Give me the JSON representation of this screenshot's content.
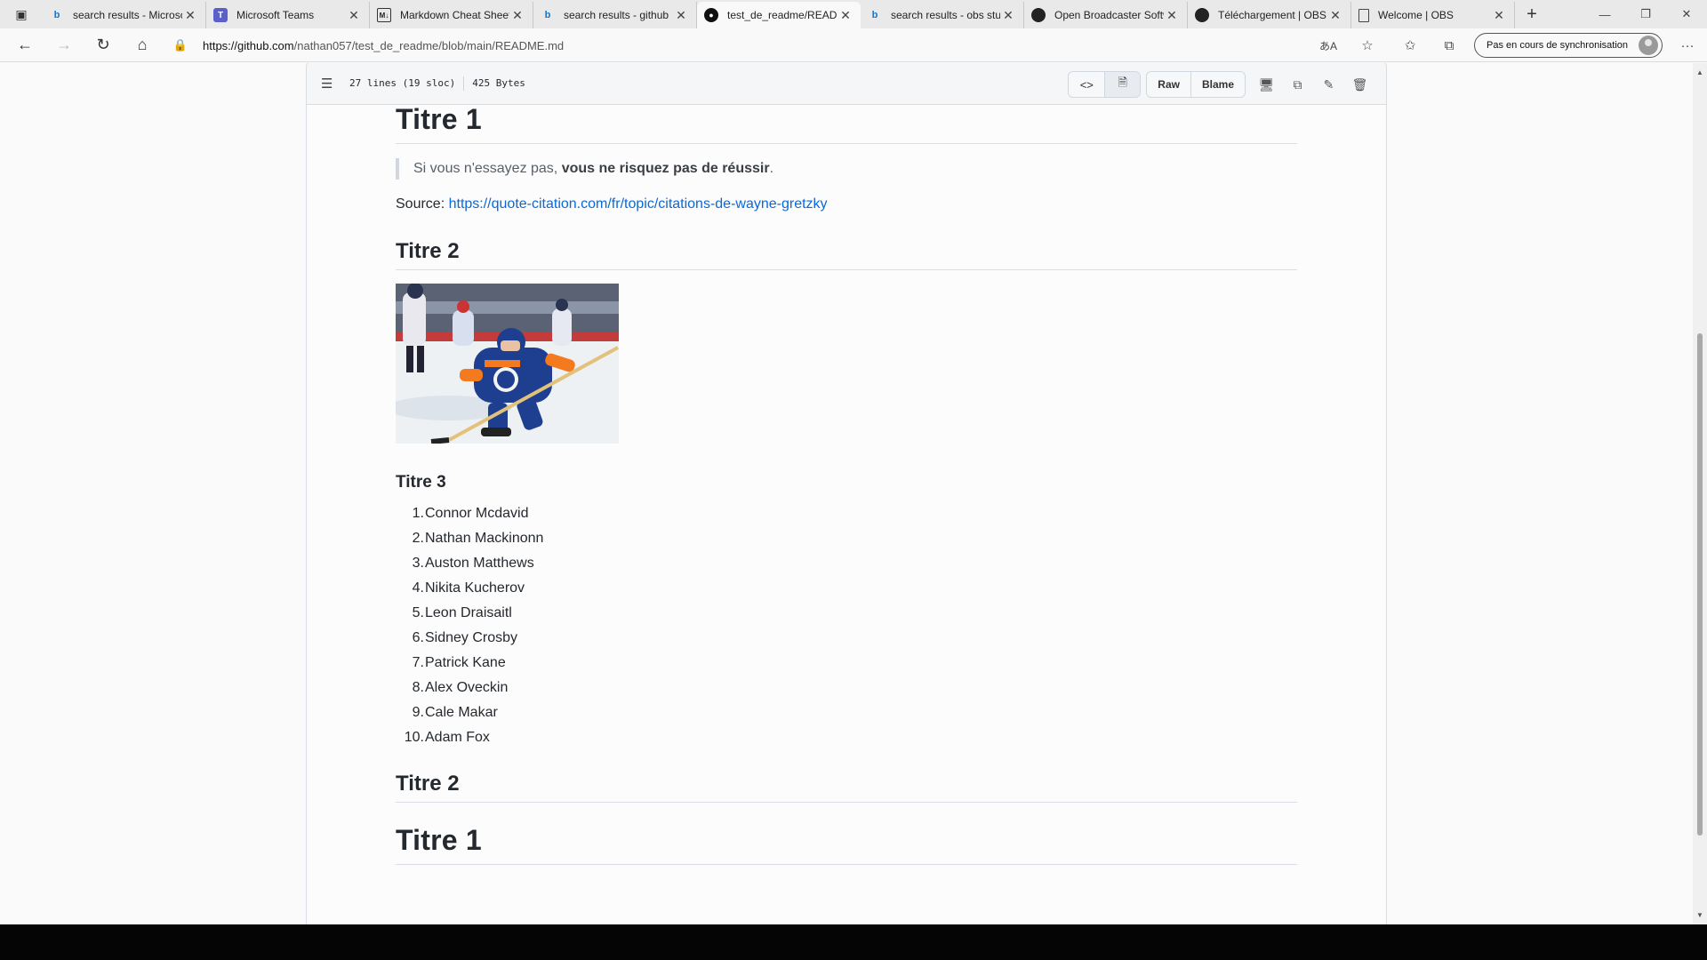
{
  "browser": {
    "tabs": [
      {
        "title": "search results - Microsoft",
        "icon": "bing-icon",
        "active": false
      },
      {
        "title": "Microsoft Teams",
        "icon": "teams-icon",
        "active": false
      },
      {
        "title": "Markdown Cheat Sheet",
        "icon": "markdown-icon",
        "active": false
      },
      {
        "title": "search results - github",
        "icon": "bing-icon",
        "active": false
      },
      {
        "title": "test_de_readme/README.md",
        "icon": "github-icon",
        "active": true
      },
      {
        "title": "search results - obs studio",
        "icon": "bing-icon",
        "active": false
      },
      {
        "title": "Open Broadcaster Software",
        "icon": "obs-icon",
        "active": false
      },
      {
        "title": "Téléchargement | OBS",
        "icon": "obs-icon",
        "active": false
      },
      {
        "title": "Welcome | OBS",
        "icon": "page-icon",
        "active": false
      }
    ],
    "url_domain": "https://github.com",
    "url_path": "/nathan057/test_de_readme/blob/main/README.md",
    "sync_label": "Pas en cours de synchronisation"
  },
  "file": {
    "lines_info": "27 lines (19 sloc)",
    "size_info": "425 Bytes",
    "raw_label": "Raw",
    "blame_label": "Blame"
  },
  "readme": {
    "h1_top": "Titre 1",
    "quote_plain": "Si vous n'essayez pas, ",
    "quote_bold": "vous ne risquez pas de réussir",
    "quote_end": ".",
    "source_label": "Source: ",
    "source_link": "https://quote-citation.com/fr/topic/citations-de-wayne-gretzky",
    "h2_first": "Titre 2",
    "h3": "Titre 3",
    "players": [
      {
        "num": "1.",
        "name": "Connor Mcdavid"
      },
      {
        "num": "2.",
        "name": "Nathan Mackinonn"
      },
      {
        "num": "3.",
        "name": "Auston Matthews"
      },
      {
        "num": "4.",
        "name": "Nikita Kucherov"
      },
      {
        "num": "5.",
        "name": "Leon Draisaitl"
      },
      {
        "num": "6.",
        "name": "Sidney Crosby"
      },
      {
        "num": "7.",
        "name": "Patrick Kane"
      },
      {
        "num": "8.",
        "name": "Alex Oveckin"
      },
      {
        "num": "9.",
        "name": "Cale Makar"
      },
      {
        "num": "10.",
        "name": "Adam Fox"
      }
    ],
    "h2_second": "Titre 2",
    "h1_bottom": "Titre 1"
  }
}
